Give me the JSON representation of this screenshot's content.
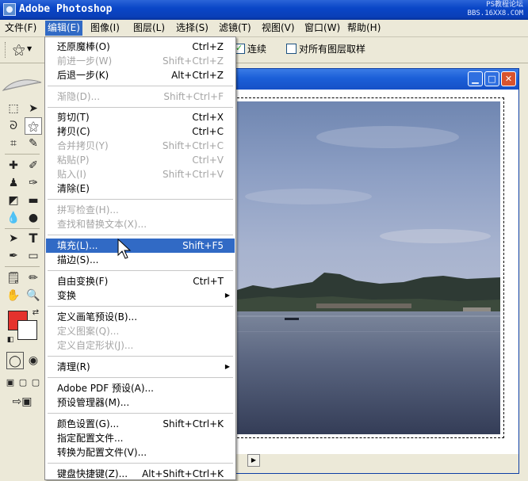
{
  "titlebar": {
    "title": "Adobe Photoshop",
    "watermark_line1": "PS教程论坛",
    "watermark_line2": "BBS.16XX8.COM"
  },
  "menubar": {
    "items": [
      {
        "label": "文件(F)"
      },
      {
        "label": "编辑(E)"
      },
      {
        "label": "图像(I)"
      },
      {
        "label": "图层(L)"
      },
      {
        "label": "选择(S)"
      },
      {
        "label": "滤镜(T)"
      },
      {
        "label": "视图(V)"
      },
      {
        "label": "窗口(W)"
      },
      {
        "label": "帮助(H)"
      }
    ],
    "active_index": 1
  },
  "options": {
    "tool_icon": "magic-wand-icon",
    "contiguous_label": "连续",
    "contiguous_checked": true,
    "sample_all_label": "对所有图层取样",
    "sample_all_checked": false
  },
  "edit_menu": {
    "items": [
      {
        "label": "还原魔棒(O)",
        "shortcut": "Ctrl+Z",
        "enabled": true
      },
      {
        "label": "前进一步(W)",
        "shortcut": "Shift+Ctrl+Z",
        "enabled": false
      },
      {
        "label": "后退一步(K)",
        "shortcut": "Alt+Ctrl+Z",
        "enabled": true
      },
      {
        "label": "渐隐(D)...",
        "shortcut": "Shift+Ctrl+F",
        "enabled": false
      },
      {
        "label": "剪切(T)",
        "shortcut": "Ctrl+X",
        "enabled": true
      },
      {
        "label": "拷贝(C)",
        "shortcut": "Ctrl+C",
        "enabled": true
      },
      {
        "label": "合并拷贝(Y)",
        "shortcut": "Shift+Ctrl+C",
        "enabled": false
      },
      {
        "label": "粘贴(P)",
        "shortcut": "Ctrl+V",
        "enabled": false
      },
      {
        "label": "贴入(I)",
        "shortcut": "Shift+Ctrl+V",
        "enabled": false
      },
      {
        "label": "清除(E)",
        "shortcut": "",
        "enabled": true
      },
      {
        "label": "拼写检查(H)...",
        "shortcut": "",
        "enabled": false
      },
      {
        "label": "查找和替换文本(X)...",
        "shortcut": "",
        "enabled": false
      },
      {
        "label": "填充(L)...",
        "shortcut": "Shift+F5",
        "enabled": true,
        "highlighted": true
      },
      {
        "label": "描边(S)...",
        "shortcut": "",
        "enabled": true
      },
      {
        "label": "自由变换(F)",
        "shortcut": "Ctrl+T",
        "enabled": true
      },
      {
        "label": "变换",
        "shortcut": "",
        "enabled": true,
        "submenu": true
      },
      {
        "label": "定义画笔预设(B)...",
        "shortcut": "",
        "enabled": true
      },
      {
        "label": "定义图案(Q)...",
        "shortcut": "",
        "enabled": false
      },
      {
        "label": "定义自定形状(J)...",
        "shortcut": "",
        "enabled": false
      },
      {
        "label": "清理(R)",
        "shortcut": "",
        "enabled": true,
        "submenu": true
      },
      {
        "label": "Adobe PDF 预设(A)...",
        "shortcut": "",
        "enabled": true
      },
      {
        "label": "预设管理器(M)...",
        "shortcut": "",
        "enabled": true
      },
      {
        "label": "颜色设置(G)...",
        "shortcut": "Shift+Ctrl+K",
        "enabled": true
      },
      {
        "label": "指定配置文件...",
        "shortcut": "",
        "enabled": true
      },
      {
        "label": "转换为配置文件(V)...",
        "shortcut": "",
        "enabled": true
      },
      {
        "label": "键盘快捷键(Z)...",
        "shortcut": "Alt+Shift+Ctrl+K",
        "enabled": true
      }
    ]
  },
  "colors": {
    "foreground": "#e5322d",
    "background": "#ffffff",
    "highlight": "#316ac5"
  },
  "document": {
    "title": ""
  }
}
